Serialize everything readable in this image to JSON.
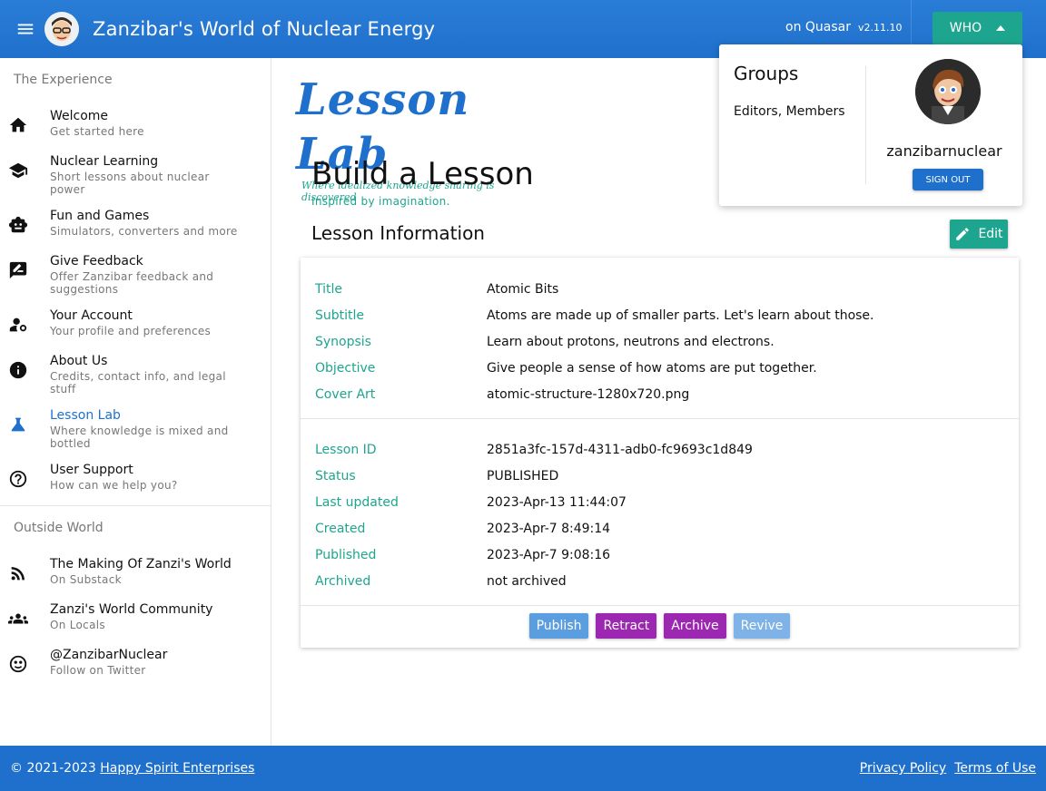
{
  "header": {
    "title": "Zanzibar's World of Nuclear Energy",
    "quasar_label": "on Quasar",
    "quasar_version": "v2.11.10",
    "who_label": "WHO"
  },
  "sidebar": {
    "section1": "The Experience",
    "items": [
      {
        "label": "Welcome",
        "caption": "Get started here",
        "icon": "home-icon"
      },
      {
        "label": "Nuclear Learning",
        "caption": "Short lessons about nuclear power",
        "icon": "school-icon"
      },
      {
        "label": "Fun and Games",
        "caption": "Simulators, converters and more",
        "icon": "robot-icon"
      },
      {
        "label": "Give Feedback",
        "caption": "Offer Zanzibar feedback and suggestions",
        "icon": "feedback-icon"
      },
      {
        "label": "Your Account",
        "caption": "Your profile and preferences",
        "icon": "manage-account-icon"
      },
      {
        "label": "About Us",
        "caption": "Credits, contact info, and legal stuff",
        "icon": "info-icon"
      },
      {
        "label": "Lesson Lab",
        "caption": "Where knowledge is mixed and bottled",
        "icon": "flask-icon"
      },
      {
        "label": "User Support",
        "caption": "How can we help you?",
        "icon": "help-icon"
      }
    ],
    "section2": "Outside World",
    "outside": [
      {
        "label": "The Making Of Zanzi's World",
        "caption": "On Substack",
        "icon": "rss-icon"
      },
      {
        "label": "Zanzi's World Community",
        "caption": "On Locals",
        "icon": "people-icon"
      },
      {
        "label": "@ZanzibarNuclear",
        "caption": "Follow on Twitter",
        "icon": "twitter-icon"
      }
    ]
  },
  "logo": {
    "title": "Lesson Lab",
    "tagline": "Where idealized knowledge sharing is discovered"
  },
  "page": {
    "title": "Build a Lesson",
    "subtitle": "Inspired by imagination.",
    "section": "Lesson Information",
    "edit_label": "Edit"
  },
  "lesson": {
    "info": [
      {
        "key": "Title",
        "value": "Atomic Bits"
      },
      {
        "key": "Subtitle",
        "value": "Atoms are made up of smaller parts. Let's learn about those."
      },
      {
        "key": "Synopsis",
        "value": "Learn about protons, neutrons and electrons."
      },
      {
        "key": "Objective",
        "value": "Give people a sense of how atoms are put together."
      },
      {
        "key": "Cover Art",
        "value": "atomic-structure-1280x720.png"
      }
    ],
    "meta": [
      {
        "key": "Lesson ID",
        "value": "2851a3fc-157d-4311-adb0-fc9693c1d849"
      },
      {
        "key": "Status",
        "value": "PUBLISHED"
      },
      {
        "key": "Last updated",
        "value": "2023-Apr-13 11:44:07"
      },
      {
        "key": "Created",
        "value": "2023-Apr-7 8:49:14"
      },
      {
        "key": "Published",
        "value": "2023-Apr-7 9:08:16"
      },
      {
        "key": "Archived",
        "value": "not archived"
      }
    ],
    "actions": [
      {
        "label": "Publish",
        "color": "#5b9ee0"
      },
      {
        "label": "Retract",
        "color": "#9c27b0"
      },
      {
        "label": "Archive",
        "color": "#9c27b0"
      },
      {
        "label": "Revive",
        "color": "#7fb2e6"
      }
    ]
  },
  "who_panel": {
    "groups_title": "Groups",
    "groups_value": "Editors, Members",
    "username": "zanzibarnuclear",
    "signout_label": "SIGN OUT"
  },
  "footer": {
    "copyright": "© 2021-2023",
    "company": "Happy Spirit Enterprises",
    "privacy": "Privacy Policy",
    "terms": "Terms of Use"
  },
  "colors": {
    "primary": "#1f70cc",
    "secondary": "#1ea58f",
    "accent": "#9c27b0"
  }
}
